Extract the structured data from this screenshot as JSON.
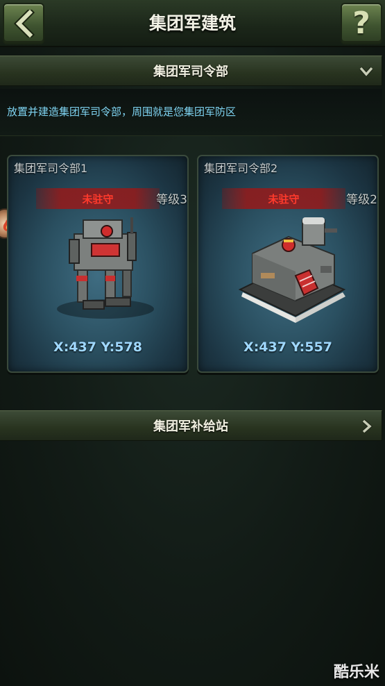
{
  "header": {
    "title": "集团军建筑",
    "back_icon": "chevron-left-icon",
    "help_label": "?"
  },
  "sections": [
    {
      "title": "集团军司令部",
      "icon": "chevron-down-icon"
    },
    {
      "title": "集团军补给站",
      "icon": "chevron-right-icon"
    }
  ],
  "description": "放置并建造集团军司令部，周围就是您集团军防区",
  "buildings": [
    {
      "name": "集团军司令部1",
      "status": "未驻守",
      "level": "等级3",
      "coords": "X:437 Y:578"
    },
    {
      "name": "集团军司令部2",
      "status": "未驻守",
      "level": "等级2",
      "coords": "X:437 Y:557"
    }
  ],
  "watermark": "酷乐米",
  "colors": {
    "status_red": "#ff3a2c",
    "coords_blue": "#9fd8ff",
    "desc_cyan": "#7fd4f2"
  }
}
